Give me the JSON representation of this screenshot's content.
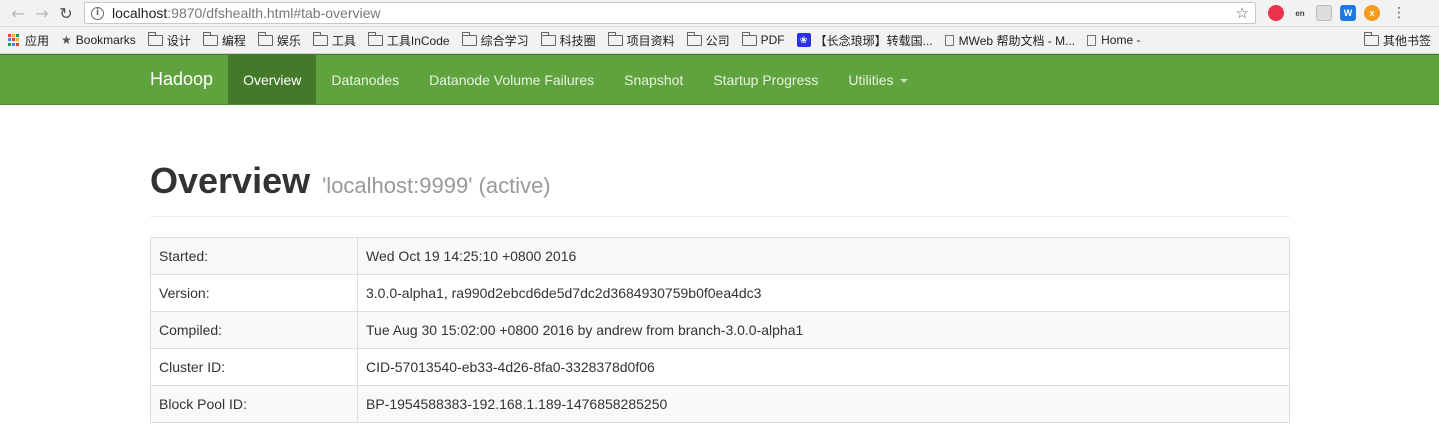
{
  "browser": {
    "url_host": "localhost",
    "url_rest": ":9870/dfshealth.html#tab-overview",
    "bookmarks": [
      {
        "type": "apps",
        "label": "应用"
      },
      {
        "type": "star",
        "label": "Bookmarks"
      },
      {
        "type": "folder",
        "label": "设计"
      },
      {
        "type": "folder",
        "label": "编程"
      },
      {
        "type": "folder",
        "label": "娱乐"
      },
      {
        "type": "folder",
        "label": "工具"
      },
      {
        "type": "folder",
        "label": "工具InCode"
      },
      {
        "type": "folder",
        "label": "综合学习"
      },
      {
        "type": "folder",
        "label": "科技圈"
      },
      {
        "type": "folder",
        "label": "项目资料"
      },
      {
        "type": "folder",
        "label": "公司"
      },
      {
        "type": "folder",
        "label": "PDF"
      },
      {
        "type": "paw",
        "label": "【长念琅琊】转载国..."
      },
      {
        "type": "page",
        "label": "MWeb 帮助文档 - M..."
      },
      {
        "type": "page",
        "label": "Home -"
      }
    ],
    "other_bookmarks": "其他书签"
  },
  "navbar": {
    "brand": "Hadoop",
    "items": [
      {
        "label": "Overview",
        "active": true
      },
      {
        "label": "Datanodes"
      },
      {
        "label": "Datanode Volume Failures"
      },
      {
        "label": "Snapshot"
      },
      {
        "label": "Startup Progress"
      },
      {
        "label": "Utilities",
        "dropdown": true
      }
    ]
  },
  "overview": {
    "title": "Overview",
    "subtitle": "'localhost:9999' (active)",
    "rows": [
      {
        "key": "Started:",
        "value": "Wed Oct 19 14:25:10 +0800 2016"
      },
      {
        "key": "Version:",
        "value": "3.0.0-alpha1, ra990d2ebcd6de5d7dc2d3684930759b0f0ea4dc3"
      },
      {
        "key": "Compiled:",
        "value": "Tue Aug 30 15:02:00 +0800 2016 by andrew from branch-3.0.0-alpha1"
      },
      {
        "key": "Cluster ID:",
        "value": "CID-57013540-eb33-4d26-8fa0-3328378d0f06"
      },
      {
        "key": "Block Pool ID:",
        "value": "BP-1954588383-192.168.1.189-1476858285250"
      }
    ]
  }
}
